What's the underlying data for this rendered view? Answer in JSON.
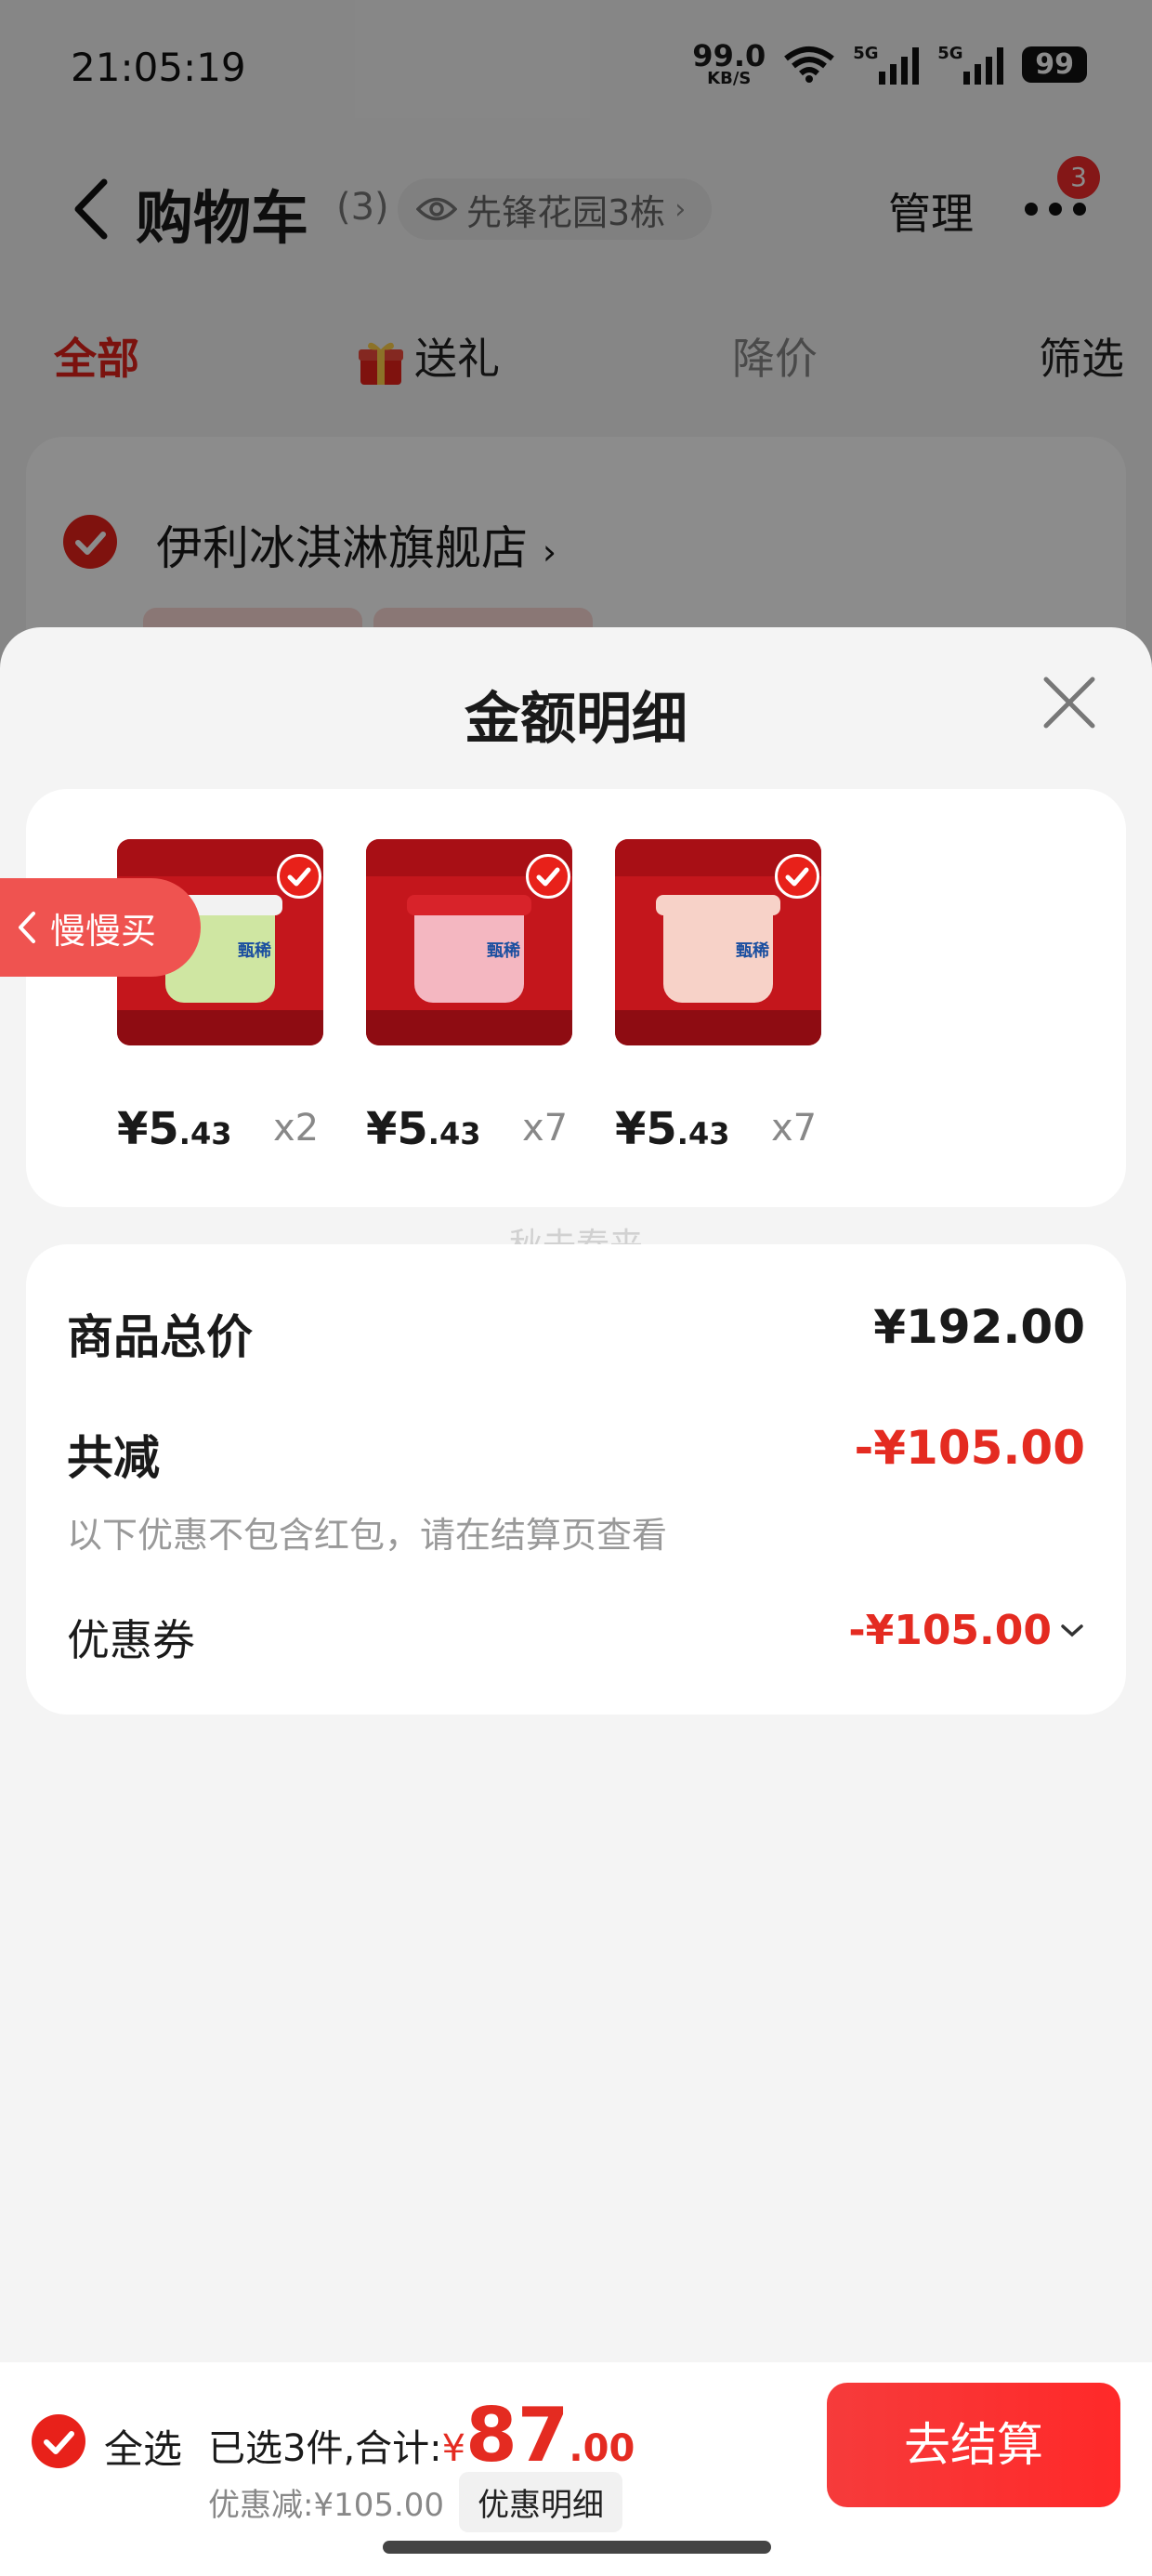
{
  "status_bar": {
    "time": "21:05:19",
    "net_speed": "99.0",
    "net_unit": "KB/S",
    "sim1": "5G",
    "sim2": "5G",
    "battery": "99"
  },
  "nav": {
    "title": "购物车",
    "count": "(3)",
    "address": "先锋花园3栋",
    "manage": "管理",
    "more_badge": "3"
  },
  "tabs": {
    "all": "全部",
    "gift": "送礼",
    "price_drop": "降价",
    "filter": "筛选"
  },
  "store": {
    "name": "伊利冰淇淋旗舰店"
  },
  "sheet": {
    "title": "金额明细",
    "watermark": "秋去春来",
    "items": [
      {
        "price_int": "¥5",
        "price_dec": ".43",
        "qty": "x2",
        "cup_color": "#cfe6a2",
        "lid_color": "#f2f2f2"
      },
      {
        "price_int": "¥5",
        "price_dec": ".43",
        "qty": "x7",
        "cup_color": "#f4b7c1",
        "lid_color": "#d8232a"
      },
      {
        "price_int": "¥5",
        "price_dec": ".43",
        "qty": "x7",
        "cup_color": "#f7d2c8",
        "lid_color": "#f7d2c8"
      }
    ],
    "item_brand": "甄稀",
    "totals": {
      "goods_total_label": "商品总价",
      "goods_total_value": "¥192.00",
      "reduction_label": "共减",
      "reduction_value": "-¥105.00",
      "reduction_note": "以下优惠不包含红包，请在结算页查看",
      "coupon_label": "优惠券",
      "coupon_value": "-¥105.00"
    }
  },
  "slow_buy": "慢慢买",
  "checkout": {
    "select_all": "全选",
    "selected_text": "已选3件,合计:",
    "currency": "¥",
    "total_int": "87",
    "total_dec": ".00",
    "discount_text": "优惠减:¥105.00",
    "detail_button": "优惠明细",
    "checkout_button": "去结算"
  },
  "colors": {
    "accent_red": "#e42b21",
    "check_red": "#e8211a"
  }
}
